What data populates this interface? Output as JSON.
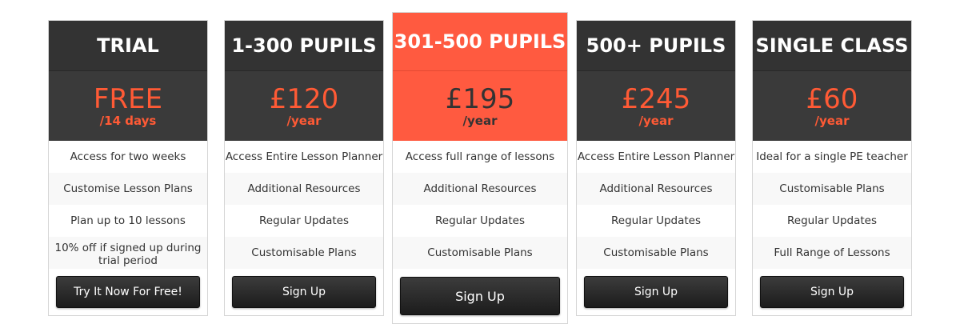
{
  "plans": [
    {
      "name": "TRIAL",
      "price": "FREE",
      "period": "/14 days",
      "features": [
        "Access for two weeks",
        "Customise Lesson Plans",
        "Plan up to 10 lessons",
        "10% off if signed up during trial period"
      ],
      "button": "Try It Now For Free!"
    },
    {
      "name": "1-300 PUPILS",
      "price": "£120",
      "period": "/year",
      "features": [
        "Access Entire Lesson Planner",
        "Additional Resources",
        "Regular Updates",
        "Customisable Plans"
      ],
      "button": "Sign Up"
    },
    {
      "name": "301-500 PUPILS",
      "price": "£195",
      "period": "/year",
      "features": [
        "Access full range of lessons",
        "Additional Resources",
        "Regular Updates",
        "Customisable Plans"
      ],
      "button": "Sign Up"
    },
    {
      "name": "500+ PUPILS",
      "price": "£245",
      "period": "/year",
      "features": [
        "Access Entire Lesson Planner",
        "Additional Resources",
        "Regular Updates",
        "Customisable Plans"
      ],
      "button": "Sign Up"
    },
    {
      "name": "SINGLE CLASS",
      "price": "£60",
      "period": "/year",
      "features": [
        "Ideal for a single PE teacher",
        "Customisable Plans",
        "Regular Updates",
        "Full Range of Lessons"
      ],
      "button": "Sign Up"
    }
  ],
  "colors": {
    "accent": "#ff5a40",
    "dark": "#333333"
  }
}
